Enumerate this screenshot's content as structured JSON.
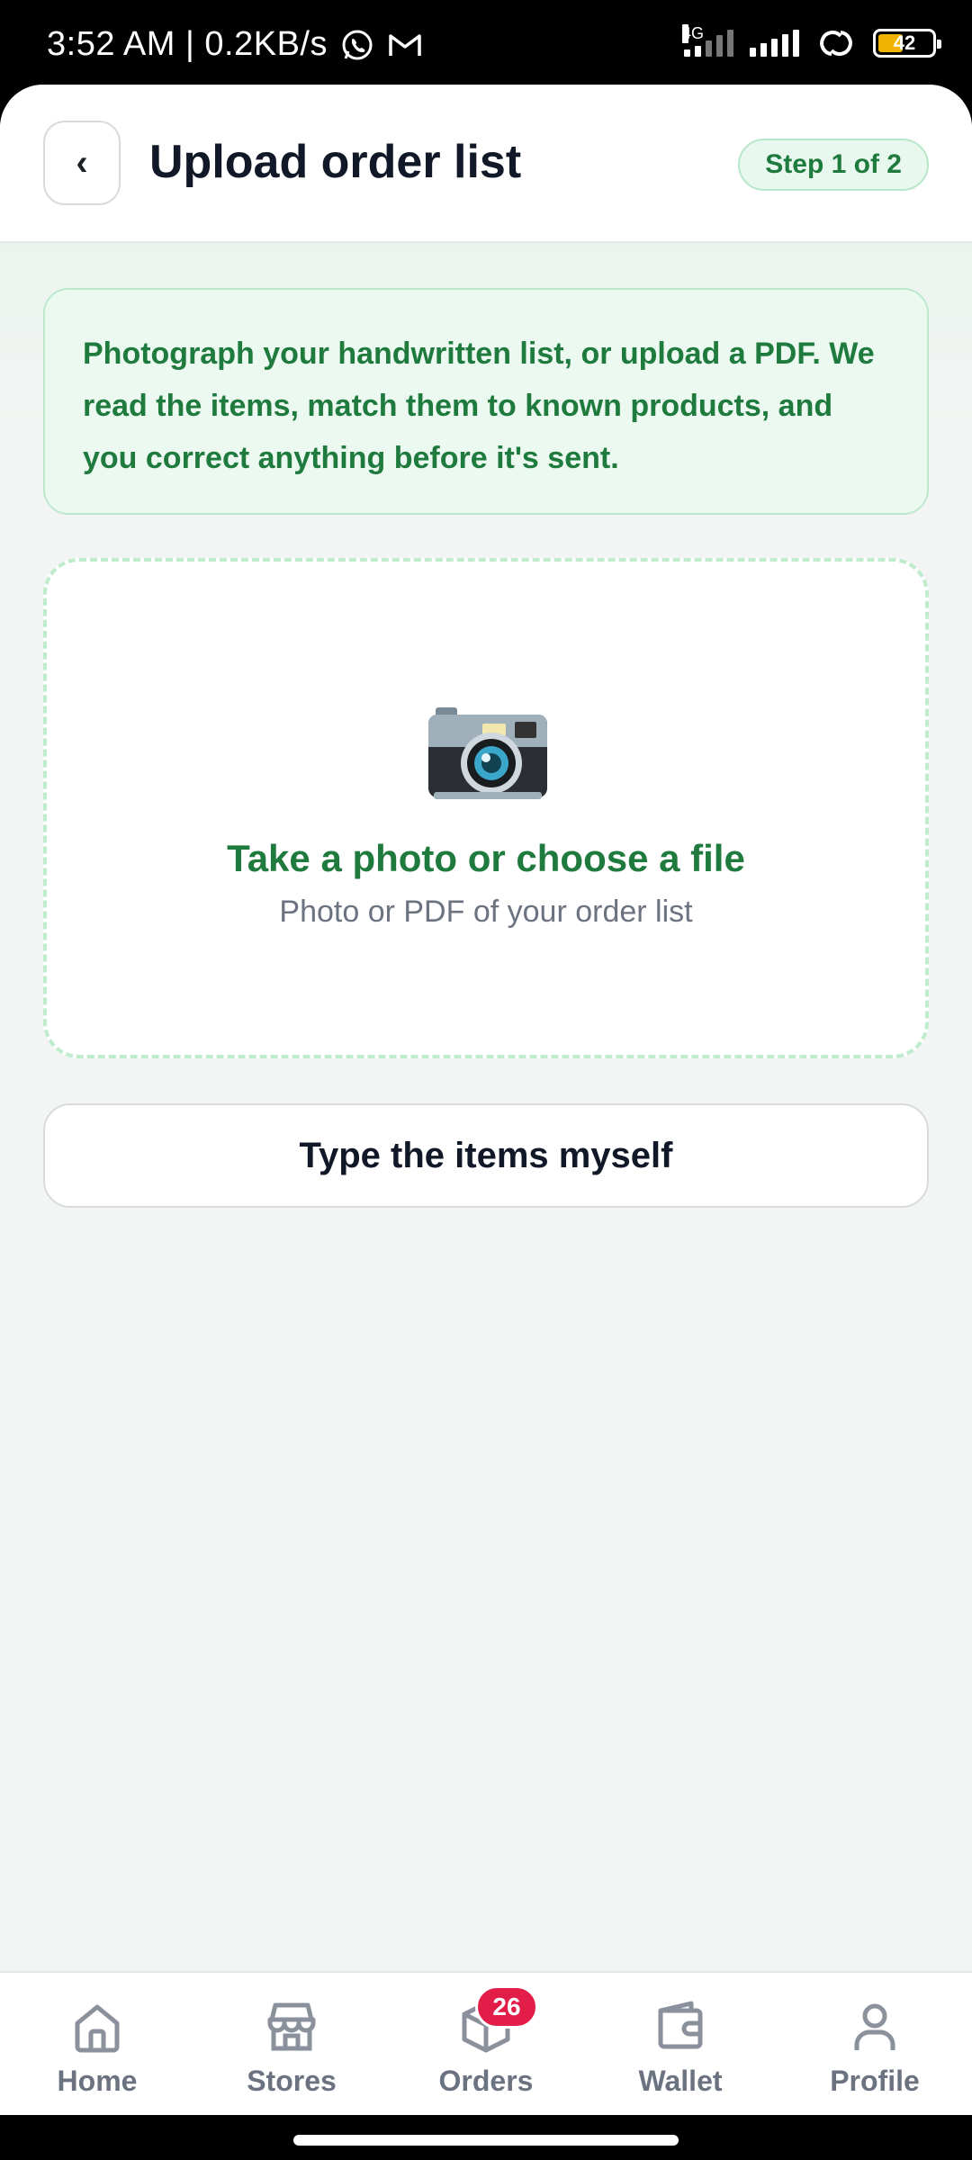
{
  "status_bar": {
    "time_speed": "3:52 AM | 0.2KB/s",
    "network": "4G",
    "battery": "42",
    "battery_level": 0.42
  },
  "header": {
    "back_label": "‹",
    "title": "Upload order list",
    "step": "Step 1 of 2"
  },
  "info": {
    "text": "Photograph your handwritten list, or upload a PDF. We read the items, match them to known products, and you correct anything before it's sent."
  },
  "upload": {
    "icon": "camera-icon",
    "title": "Take a photo or choose a file",
    "subtitle": "Photo or PDF of your order list"
  },
  "manual_button": {
    "label": "Type the items myself"
  },
  "nav": {
    "items": [
      {
        "label": "Home",
        "icon": "home-icon"
      },
      {
        "label": "Stores",
        "icon": "store-icon"
      },
      {
        "label": "Orders",
        "icon": "box-icon",
        "badge": "26"
      },
      {
        "label": "Wallet",
        "icon": "wallet-icon"
      },
      {
        "label": "Profile",
        "icon": "person-icon"
      }
    ]
  },
  "colors": {
    "accent_green": "#1f7a3d",
    "badge_red": "#e11d48",
    "muted_gray": "#6b7280"
  }
}
